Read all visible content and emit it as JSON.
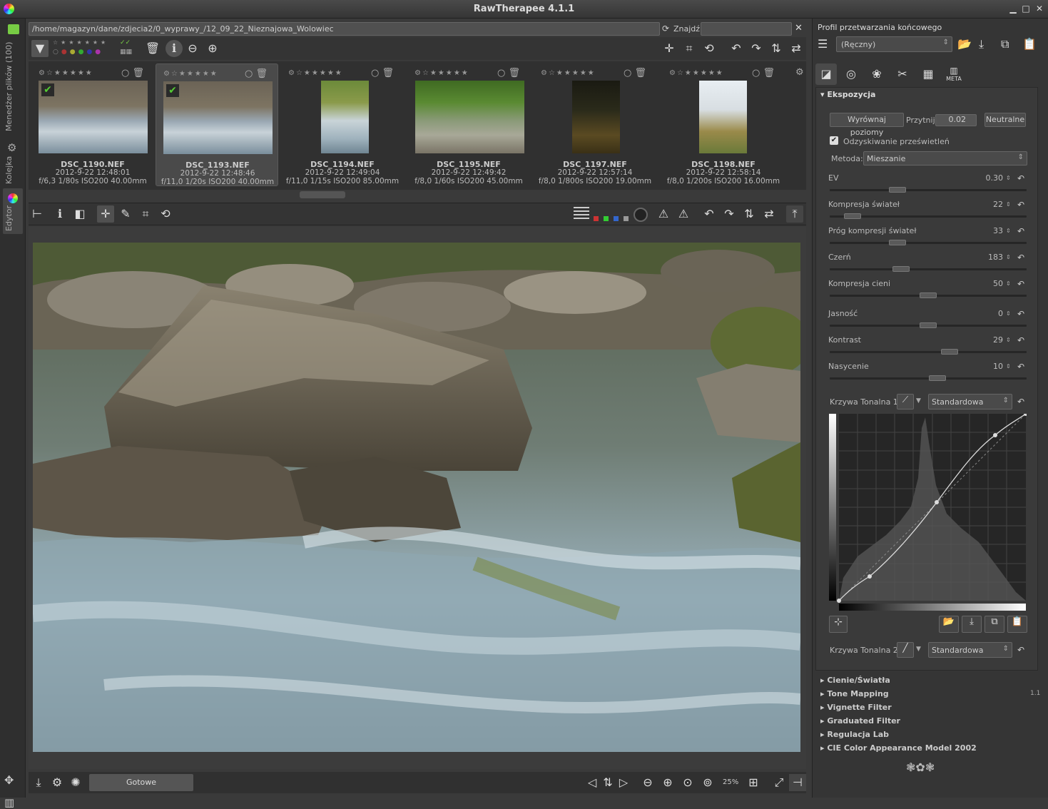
{
  "window": {
    "title": "RawTherapee 4.1.1"
  },
  "side_tabs": [
    "Menedżer plików (100)",
    "Kolejka",
    "Edytor"
  ],
  "browser": {
    "path": "/home/magazyn/dane/zdjecia2/0_wyprawy_/12_09_22_Nieznajowa_Wolowiec",
    "find_label": "Znajdź:",
    "find_value": ""
  },
  "thumbnails": [
    {
      "name": "DSC_1190.NEF",
      "date": "2012-9-22 12:48:01",
      "info": "f/6,3 1/80s ISO200 40.00mm",
      "selected": false,
      "checked": true
    },
    {
      "name": "DSC_1193.NEF",
      "date": "2012-9-22 12:48:46",
      "info": "f/11,0 1/20s ISO200 40.00mm",
      "selected": true,
      "checked": true
    },
    {
      "name": "DSC_1194.NEF",
      "date": "2012-9-22 12:49:04",
      "info": "f/11,0 1/15s ISO200 85.00mm",
      "selected": false,
      "checked": false
    },
    {
      "name": "DSC_1195.NEF",
      "date": "2012-9-22 12:49:42",
      "info": "f/8,0 1/60s ISO200 45.00mm",
      "selected": false,
      "checked": false
    },
    {
      "name": "DSC_1197.NEF",
      "date": "2012-9-22 12:57:14",
      "info": "f/8,0 1/800s ISO200 19.00mm",
      "selected": false,
      "checked": false
    },
    {
      "name": "DSC_1198.NEF",
      "date": "2012-9-22 12:58:14",
      "info": "f/8,0 1/200s ISO200 16.00mm",
      "selected": false,
      "checked": false
    }
  ],
  "status": {
    "ready": "Gotowe",
    "zoom": "25%"
  },
  "right": {
    "profile_label": "Profil przetwarzania końcowego",
    "profile_value": "(Ręczny)",
    "tabs": [
      "exposure",
      "detail",
      "color",
      "transform",
      "raw",
      "META"
    ],
    "section": "Ekspozycja",
    "btn_auto": "Wyrównaj poziomy",
    "clip_label": "Przytnij",
    "clip_value": "0.02",
    "btn_neutral": "Neutralne",
    "recovery_label": "Odzyskiwanie prześwietleń",
    "method_label": "Metoda:",
    "method_value": "Mieszanie",
    "sliders": [
      {
        "label": "EV",
        "value": "0.30",
        "frac": 0.33
      },
      {
        "label": "Kompresja świateł",
        "value": "22",
        "frac": 0.08
      },
      {
        "label": "Próg kompresji świateł",
        "value": "33",
        "frac": 0.33
      },
      {
        "label": "Czerń",
        "value": "183",
        "frac": 0.35
      },
      {
        "label": "Kompresja cieni",
        "value": "50",
        "frac": 0.5
      },
      {
        "label": "Jasność",
        "value": "0",
        "frac": 0.5
      },
      {
        "label": "Kontrast",
        "value": "29",
        "frac": 0.62
      },
      {
        "label": "Nasycenie",
        "value": "10",
        "frac": 0.55
      }
    ],
    "curve1_label": "Krzywa Tonalna 1:",
    "curve1_value": "Standardowa",
    "curve2_label": "Krzywa Tonalna 2:",
    "curve2_value": "Standardowa",
    "collapsed_sections": [
      "Cienie/Światła",
      "Tone Mapping",
      "Vignette Filter",
      "Graduated Filter",
      "Regulacja Lab",
      "CIE Color Appearance Model 2002"
    ],
    "tone_mapping_badge": "1.1"
  }
}
